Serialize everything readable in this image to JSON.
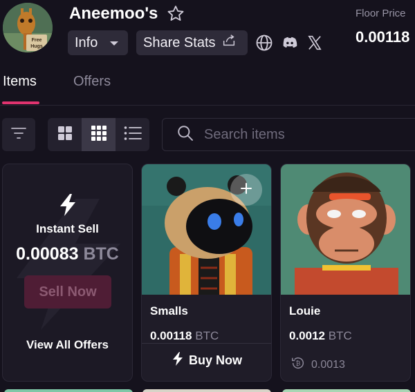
{
  "collection": {
    "name": "Aneemoo's",
    "avatar_caption": "Free Hugs",
    "floor_label": "Floor Price",
    "floor_value": "0.00118"
  },
  "header_buttons": {
    "info_label": "Info",
    "share_label": "Share Stats"
  },
  "icons": {
    "star": "star-icon",
    "globe": "globe-icon",
    "discord": "discord-icon",
    "x": "x-icon"
  },
  "tabs": [
    {
      "label": "Items",
      "active": true
    },
    {
      "label": "Offers",
      "active": false
    }
  ],
  "toolbar": {
    "view_modes": [
      "grid-large",
      "grid-small",
      "list"
    ],
    "selected_view": "grid-small",
    "search_placeholder": "Search items"
  },
  "instant_sell": {
    "title": "Instant Sell",
    "price": "0.00083",
    "unit": "BTC",
    "button_label": "Sell Now",
    "view_all_label": "View All Offers"
  },
  "items": [
    {
      "name": "Smalls",
      "price": "0.00118",
      "unit": "BTC",
      "action_label": "Buy Now"
    },
    {
      "name": "Louie",
      "price": "0.0012",
      "unit": "BTC",
      "last_sale": "0.0013"
    }
  ],
  "colors": {
    "background": "#15121d",
    "accent": "#e0336f",
    "card": "#1f1c28",
    "muted_text": "#8d899a"
  }
}
